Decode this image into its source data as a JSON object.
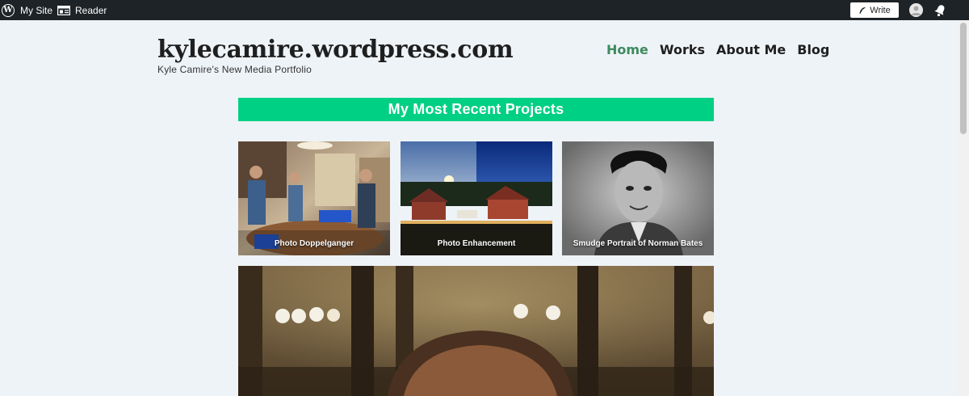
{
  "adminbar": {
    "my_site": "My Site",
    "reader": "Reader",
    "write": "Write"
  },
  "header": {
    "title": "kylecamire.wordpress.com",
    "tagline": "Kyle Camire's New Media Portfolio"
  },
  "nav": {
    "items": [
      "Home",
      "Works",
      "About Me",
      "Blog"
    ],
    "active": "Home"
  },
  "section": {
    "title": "My Most Recent Projects"
  },
  "projects": [
    {
      "label": "Photo Doppelganger"
    },
    {
      "label": "Photo Enhancement"
    },
    {
      "label": "Smudge Portrait of Norman Bates"
    }
  ],
  "colors": {
    "admin_bar": "#1e2327",
    "page_bg": "#eef3f7",
    "banner": "#00d084",
    "nav_active": "#3e8a5f"
  }
}
